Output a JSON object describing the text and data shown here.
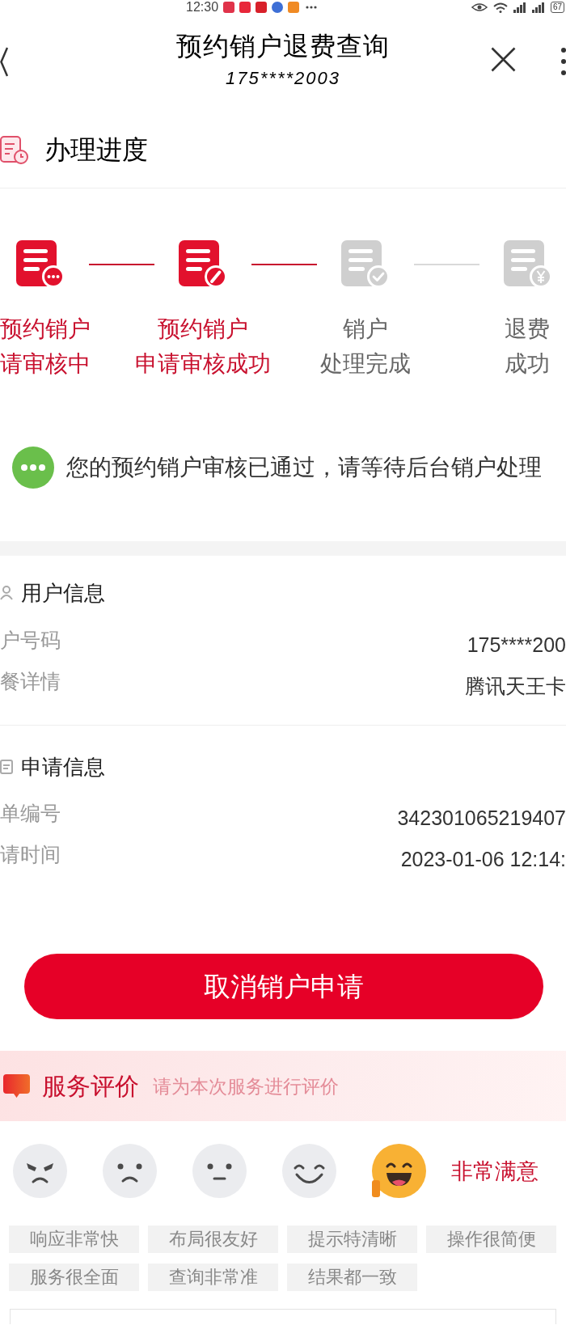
{
  "status_bar": {
    "time": "12:30",
    "battery": "67"
  },
  "header": {
    "title": "预约销户退费查询",
    "subtitle": "175****2003"
  },
  "progress": {
    "title": "办理进度",
    "steps": [
      {
        "line1": "预约销户",
        "line2": "请审核中",
        "done": true
      },
      {
        "line1": "预约销户",
        "line2": "申请审核成功",
        "done": true
      },
      {
        "line1": "销户",
        "line2": "处理完成",
        "done": false
      },
      {
        "line1": "退费",
        "line2": "成功",
        "done": false
      }
    ]
  },
  "notice": {
    "text": "您的预约销户审核已通过，请等待后台销户处理"
  },
  "user_info": {
    "title": "用户信息",
    "rows": [
      {
        "label": "户号码",
        "value": "175****200"
      },
      {
        "label": "餐详情",
        "value": "腾讯天王卡"
      }
    ]
  },
  "application_info": {
    "title": "申请信息",
    "rows": [
      {
        "label": "单编号",
        "value": "342301065219407"
      },
      {
        "label": "请时间",
        "value": "2023-01-06 12:14:"
      }
    ]
  },
  "cancel_button": {
    "label": "取消销户申请"
  },
  "rating": {
    "title": "服务评价",
    "hint": "请为本次服务进行评价",
    "faces": [
      {
        "selected": false
      },
      {
        "selected": false
      },
      {
        "selected": false
      },
      {
        "selected": false
      },
      {
        "selected": true
      }
    ],
    "selected_label": "非常满意",
    "tags": [
      {
        "label": "响应非常快",
        "selected": false
      },
      {
        "label": "布局很友好",
        "selected": false
      },
      {
        "label": "提示特清晰",
        "selected": false
      },
      {
        "label": "操作很简便",
        "selected": false
      },
      {
        "label": "服务很全面",
        "selected": false
      },
      {
        "label": "查询非常准",
        "selected": false
      },
      {
        "label": "结果都一致",
        "selected": false
      }
    ]
  }
}
